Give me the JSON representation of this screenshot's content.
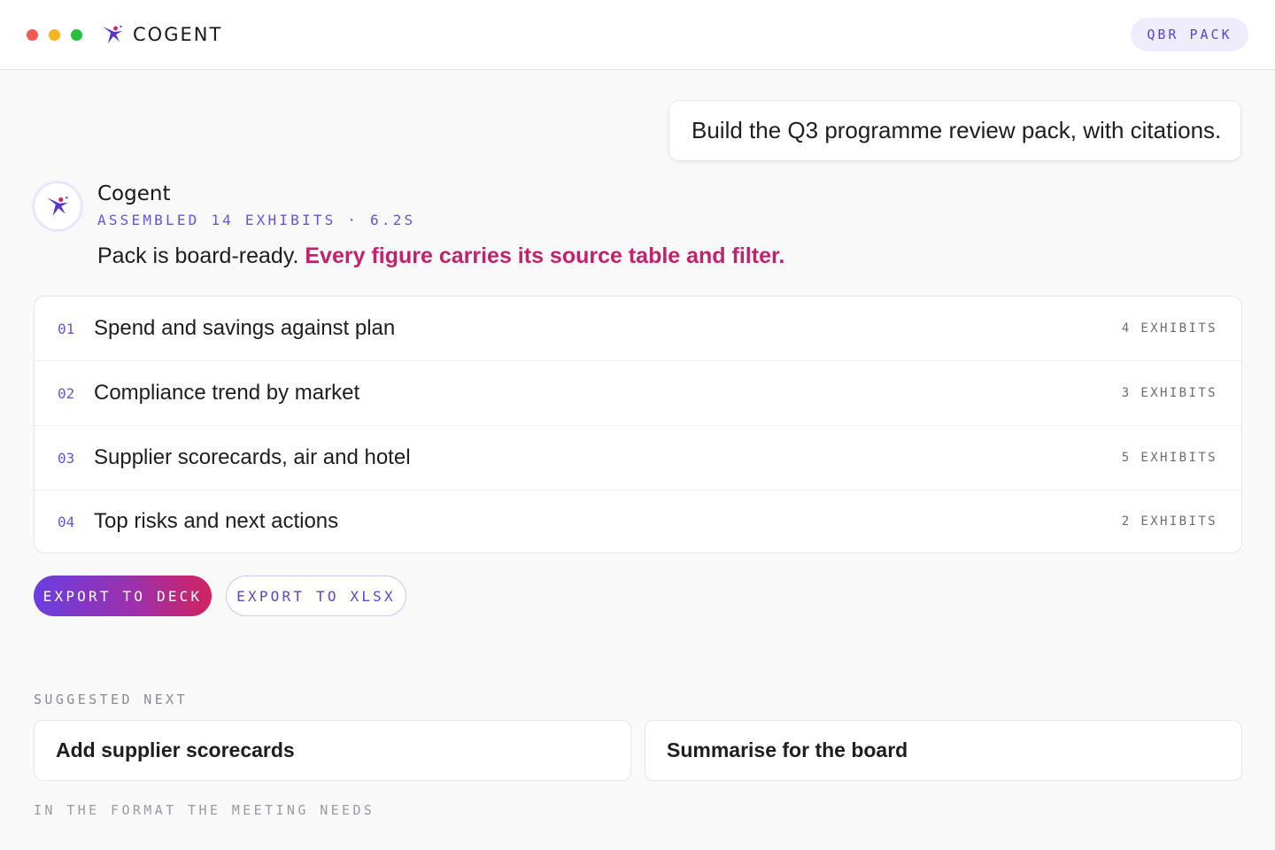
{
  "window": {
    "controls": [
      "close",
      "minimize",
      "maximize"
    ]
  },
  "brand": {
    "name": "COGENT",
    "icon": "spark-figure-icon"
  },
  "header": {
    "pill_label": "QBR PACK"
  },
  "user_message": {
    "text": "Build the Q3 programme review pack, with citations."
  },
  "assistant": {
    "name": "Cogent",
    "meta": "ASSEMBLED 14 EXHIBITS · 6.2S",
    "text_plain": "Pack is board-ready. ",
    "text_highlight": "Every figure carries its source table and filter."
  },
  "outline": {
    "items": [
      {
        "num": "01",
        "title": "Spend and savings against plan",
        "count": "4 EXHIBITS"
      },
      {
        "num": "02",
        "title": "Compliance trend by market",
        "count": "3 EXHIBITS"
      },
      {
        "num": "03",
        "title": "Supplier scorecards, air and hotel",
        "count": "5 EXHIBITS"
      },
      {
        "num": "04",
        "title": "Top risks and next actions",
        "count": "2 EXHIBITS"
      }
    ]
  },
  "actions": {
    "deck_label": "EXPORT TO DECK",
    "xlsx_label": "EXPORT TO XLSX"
  },
  "suggestions": {
    "label": "SUGGESTED NEXT",
    "items": [
      "Add supplier scorecards",
      "Summarise for the board"
    ],
    "footer": "IN THE FORMAT THE MEETING NEEDS"
  },
  "colors": {
    "accent": "#6a54d6",
    "highlight": "#c2226b",
    "gradient_start": "#6a3ee0",
    "gradient_end": "#d1235e"
  }
}
